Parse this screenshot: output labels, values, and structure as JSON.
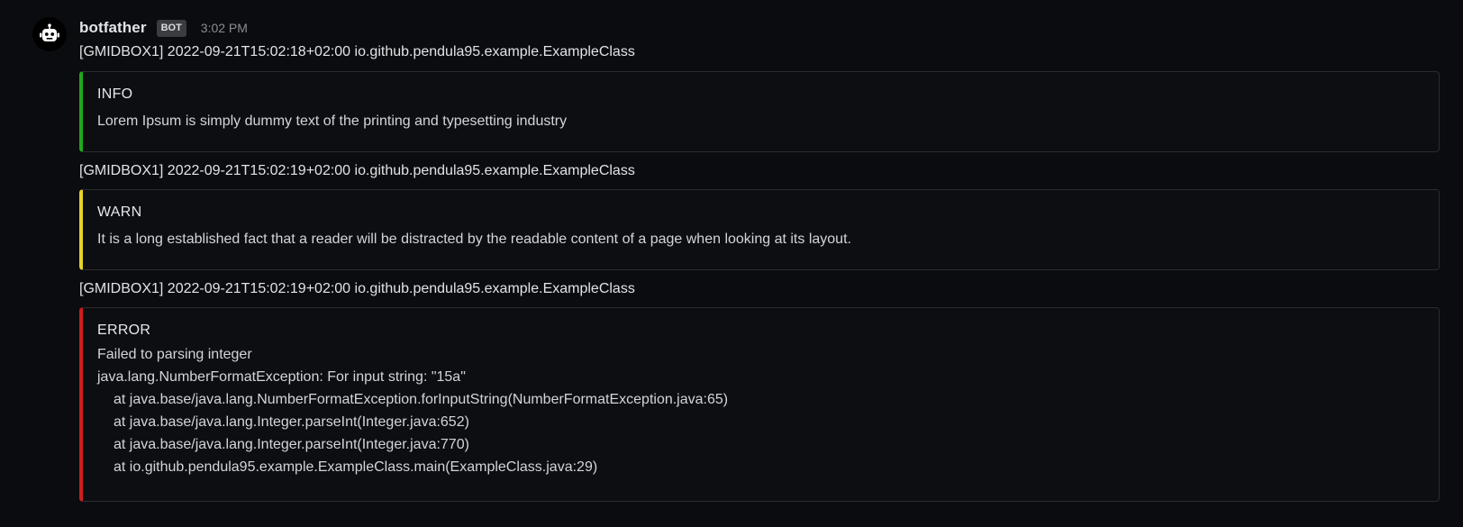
{
  "message": {
    "author": "botfather",
    "badge": "BOT",
    "time": "3:02 PM",
    "avatar_icon": "robot-icon"
  },
  "entries": [
    {
      "source": "[GMIDBOX1] 2022-09-21T15:02:18+02:00 io.github.pendula95.example.ExampleClass",
      "level": "INFO",
      "color": "#1ea81e",
      "text": "Lorem Ipsum is simply dummy text of the printing and typesetting industry"
    },
    {
      "source": "[GMIDBOX1] 2022-09-21T15:02:19+02:00 io.github.pendula95.example.ExampleClass",
      "level": "WARN",
      "color": "#e5d22a",
      "text": "It is a long established fact that a reader will be distracted by the readable content of a page when looking at its layout."
    },
    {
      "source": "[GMIDBOX1] 2022-09-21T15:02:19+02:00 io.github.pendula95.example.ExampleClass",
      "level": "ERROR",
      "color": "#cf1d1d",
      "text": "Failed to parsing integer",
      "exception": "java.lang.NumberFormatException: For input string: \"15a\"",
      "stack": [
        "at java.base/java.lang.NumberFormatException.forInputString(NumberFormatException.java:65)",
        "at java.base/java.lang.Integer.parseInt(Integer.java:652)",
        "at java.base/java.lang.Integer.parseInt(Integer.java:770)",
        "at io.github.pendula95.example.ExampleClass.main(ExampleClass.java:29)"
      ]
    }
  ]
}
